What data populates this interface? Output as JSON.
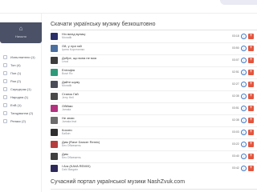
{
  "sidebar": {
    "home_label": "Начало",
    "home_icon": "home-icon",
    "items": [
      {
        "label": "Изпълнители (1)",
        "icon": "user-icon"
      },
      {
        "label": "Топ (4)",
        "icon": "chart-icon"
      },
      {
        "label": "Поп (1)",
        "icon": "music-icon"
      },
      {
        "label": "Рап (2)",
        "icon": "mic-icon"
      },
      {
        "label": "Саундтрак (1)",
        "icon": "film-icon"
      },
      {
        "label": "Народна (1)",
        "icon": "folk-icon"
      },
      {
        "label": "EnB (1)",
        "icon": "note-icon"
      },
      {
        "label": "Танцувални (2)",
        "icon": "dance-icon"
      },
      {
        "label": "Релакс (2)",
        "icon": "relax-icon"
      }
    ]
  },
  "main": {
    "title": "Скачати українську музику безкоштовно",
    "tracks": [
      {
        "name": "Ніч вихід вулиці",
        "artist": "Monatik",
        "duration": "03:18",
        "color": "#2a2f6a"
      },
      {
        "name": "Ой, у лузі гай",
        "artist": "Ірина Коротоєнко",
        "duration": "03:50",
        "color": "#4b6f9f"
      },
      {
        "name": "Добре, що вона не моя",
        "artist": "Leczi",
        "duration": "03:07",
        "color": "#3c3c3c"
      },
      {
        "name": "Епітафія",
        "artist": "Bosé Ro",
        "duration": "02:51",
        "color": "#2e9a79"
      },
      {
        "name": "Дайте шуму",
        "artist": "Monatik",
        "duration": "02:27",
        "color": "#4a4c58"
      },
      {
        "name": "Станок Гай",
        "artist": "Jerry Heil",
        "duration": "02:35",
        "color": "#4a4a4a"
      },
      {
        "name": "Обійми",
        "artist": "Jamala",
        "duration": "03:51",
        "color": "#b3327f"
      },
      {
        "name": "Не знаю",
        "artist": "Jamala feat",
        "duration": "02:35",
        "color": "#6d6d6d"
      },
      {
        "name": "Кохати",
        "artist": "Бабкін",
        "duration": "03:03",
        "color": "#2f2f2f"
      },
      {
        "name": "Дим (Rave Dancer Remix)",
        "artist": "Без Обмежень",
        "duration": "03:22",
        "color": "#b63d3d"
      },
      {
        "name": "Дим",
        "artist": "Без Обмежень",
        "duration": "03:40",
        "color": "#3f3f3f"
      },
      {
        "name": "I Ara (KAVA REMIX)",
        "artist": "Dzhi Bargain",
        "duration": "03:42",
        "color": "#2d2a5a"
      }
    ],
    "download_icon": "download-icon",
    "add_icon": "plus-icon"
  },
  "footer": {
    "portal_title": "Сучасний портал української музики NashZvuk.com"
  },
  "colors": {
    "sidebar_home": "#4b5166",
    "download_blue": "#3f76c8",
    "add_red": "#e3553d"
  }
}
